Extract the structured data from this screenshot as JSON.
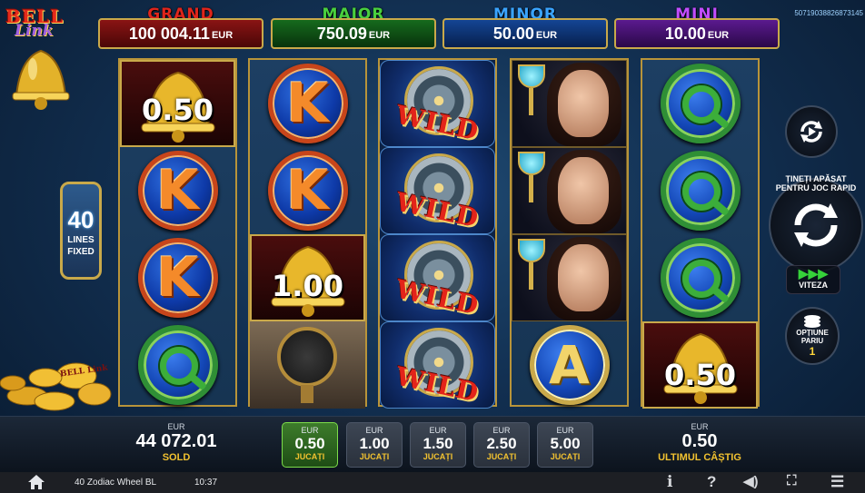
{
  "logo": {
    "line1": "BELL",
    "line2": "Link"
  },
  "session_id": "50719038826873145",
  "jackpots": [
    {
      "label": "GRAND",
      "amount": "100 004.11",
      "currency": "EUR",
      "label_color": "#e0251b",
      "box_color": "#6a0d0d"
    },
    {
      "label": "MAJOR",
      "amount": "750.09",
      "currency": "EUR",
      "label_color": "#49d03e",
      "box_color": "#0e4a14"
    },
    {
      "label": "MINOR",
      "amount": "50.00",
      "currency": "EUR",
      "label_color": "#3aa4ff",
      "box_color": "#0c2f6a"
    },
    {
      "label": "MINI",
      "amount": "10.00",
      "currency": "EUR",
      "label_color": "#c14dff",
      "box_color": "#3d1066"
    }
  ],
  "lines": {
    "count": "40",
    "label1": "LINES",
    "label2": "FIXED"
  },
  "reels": {
    "r1": [
      "bell:0.50",
      "K",
      "K",
      "Q"
    ],
    "r2": [
      "K",
      "K",
      "bell:1.00",
      "globe"
    ],
    "r3": [
      "WILD",
      "WILD",
      "WILD",
      "WILD"
    ],
    "r4": [
      "lady",
      "lady",
      "lady",
      "A"
    ],
    "r5": [
      "Q",
      "Q",
      "Q",
      "bell:0.50"
    ]
  },
  "bell_values": {
    "r1": "0.50",
    "r2": "1.00",
    "r5": "0.50"
  },
  "wild_label": "WILD",
  "coin_text": "BELL Link",
  "controls": {
    "spin_label": "ȚINEȚI APĂSAT PENTRU JOC RAPID",
    "speed_label": "VITEZA",
    "bet_option_label": "OPȚIUNE PARIU",
    "bet_option_value": "1"
  },
  "bottom": {
    "balance": {
      "currency": "EUR",
      "amount": "44 072.01",
      "label": "SOLD"
    },
    "bets": [
      {
        "currency": "EUR",
        "value": "0.50",
        "label": "JUCAȚI",
        "active": true
      },
      {
        "currency": "EUR",
        "value": "1.00",
        "label": "JUCAȚI",
        "active": false
      },
      {
        "currency": "EUR",
        "value": "1.50",
        "label": "JUCAȚI",
        "active": false
      },
      {
        "currency": "EUR",
        "value": "2.50",
        "label": "JUCAȚI",
        "active": false
      },
      {
        "currency": "EUR",
        "value": "5.00",
        "label": "JUCAȚI",
        "active": false
      }
    ],
    "last_win": {
      "currency": "EUR",
      "amount": "0.50",
      "label": "ULTIMUL CÂȘTIG"
    }
  },
  "status": {
    "game_title": "40 Zodiac Wheel BL",
    "time": "10:37",
    "icons": [
      "home-icon",
      "info-icon",
      "help-icon",
      "sound-icon",
      "fullscreen-icon",
      "menu-icon"
    ]
  }
}
